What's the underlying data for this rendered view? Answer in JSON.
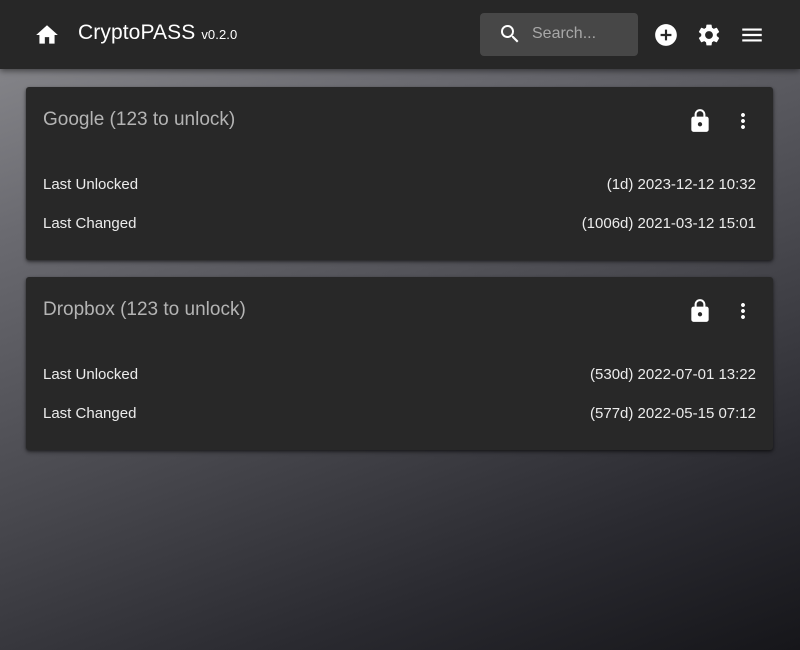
{
  "header": {
    "app_name": "CryptoPASS",
    "version": "v0.2.0",
    "search_placeholder": "Search...",
    "icons": [
      "home-icon",
      "search-icon",
      "add-circle-icon",
      "gear-icon",
      "menu-icon"
    ]
  },
  "entries": [
    {
      "title": "Google (123 to unlock)",
      "rows": [
        {
          "label": "Last Unlocked",
          "value": "(1d) 2023-12-12 10:32"
        },
        {
          "label": "Last Changed",
          "value": "(1006d) 2021-03-12 15:01"
        }
      ]
    },
    {
      "title": "Dropbox (123 to unlock)",
      "rows": [
        {
          "label": "Last Unlocked",
          "value": "(530d) 2022-07-01 13:22"
        },
        {
          "label": "Last Changed",
          "value": "(577d) 2022-05-15 07:12"
        }
      ]
    }
  ],
  "colors": {
    "appbar": "#272727",
    "card": "#282828",
    "search_bg": "#474747"
  }
}
